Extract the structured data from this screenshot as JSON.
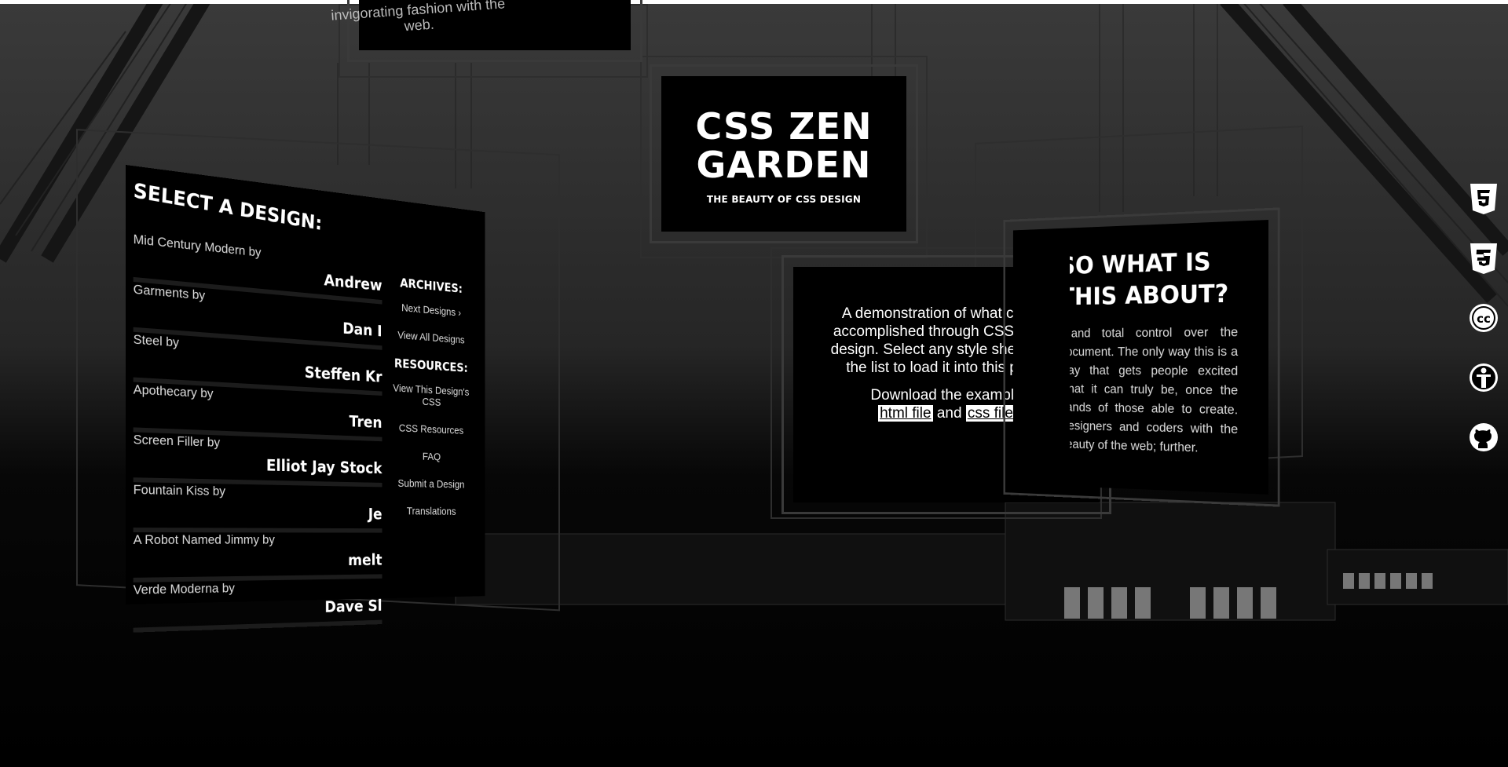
{
  "top_sign": {
    "text": "invigorating fashion with the web."
  },
  "title_sign": {
    "title": "CSS ZEN GARDEN",
    "subtitle": "THE BEAUTY OF CSS DESIGN"
  },
  "select_panel": {
    "heading": "SELECT A DESIGN:",
    "designs": [
      {
        "name": "Mid Century Modern by",
        "author": "Andrew"
      },
      {
        "name": "Garments by",
        "author": "Dan I"
      },
      {
        "name": "Steel by",
        "author": "Steffen Kr"
      },
      {
        "name": "Apothecary by",
        "author": "Tren"
      },
      {
        "name": "Screen Filler by",
        "author": "Elliot Jay Stock"
      },
      {
        "name": "Fountain Kiss by",
        "author": "Je"
      },
      {
        "name": "A Robot Named Jimmy by",
        "author": "melt"
      },
      {
        "name": "Verde Moderna by",
        "author": "Dave Sl"
      }
    ],
    "archives_heading": "ARCHIVES:",
    "next_designs": "Next Designs ›",
    "view_all": "View All Designs",
    "resources_heading": "RESOURCES:",
    "view_css": "View This Design's CSS",
    "css_resources": "CSS Resources",
    "faq": "FAQ",
    "submit": "Submit a Design",
    "translations": "Translations"
  },
  "intro_panel": {
    "p1": "A demonstration of what can be accomplished through CSS-based design. Select any style sheet from the list to load it into this page.",
    "p2_prefix": "Download the example",
    "html_file": "html file",
    "and": "and",
    "css_file": "css file"
  },
  "about_panel": {
    "heading": "SO WHAT IS THIS ABOUT?",
    "body": "…and total control over the document. The only way this is a way that gets people excited what it can truly be, once the hands of those able to create. Designers and coders with the beauty of the web; further."
  },
  "icons": [
    "html5-icon",
    "css3-icon",
    "creative-commons-icon",
    "accessibility-icon",
    "github-icon"
  ]
}
